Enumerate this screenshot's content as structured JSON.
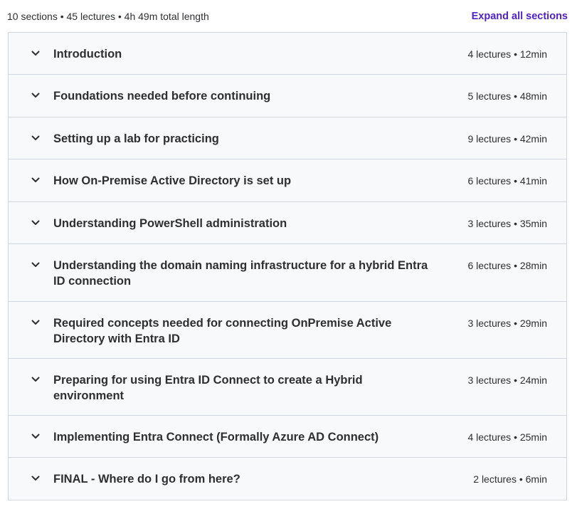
{
  "summary": {
    "text": "10 sections • 45 lectures • 4h 49m total length",
    "expand_all_label": "Expand all sections"
  },
  "sections": [
    {
      "title": "Introduction",
      "meta": "4 lectures • 12min"
    },
    {
      "title": "Foundations needed before continuing",
      "meta": "5 lectures • 48min"
    },
    {
      "title": "Setting up a lab for practicing",
      "meta": "9 lectures • 42min"
    },
    {
      "title": "How On-Premise Active Directory is set up",
      "meta": "6 lectures • 41min"
    },
    {
      "title": "Understanding PowerShell administration",
      "meta": "3 lectures • 35min"
    },
    {
      "title": "Understanding the domain naming infrastructure for a hybrid Entra ID connection",
      "meta": "6 lectures • 28min"
    },
    {
      "title": "Required concepts needed for connecting OnPremise Active Directory with Entra ID",
      "meta": "3 lectures • 29min"
    },
    {
      "title": "Preparing for using Entra ID Connect to create a Hybrid environment",
      "meta": "3 lectures • 24min"
    },
    {
      "title": "Implementing Entra Connect (Formally Azure AD Connect)",
      "meta": "4 lectures • 25min"
    },
    {
      "title": "FINAL - Where do I go from here?",
      "meta": "2 lectures • 6min"
    }
  ],
  "icons": {
    "section_toggle": "chevron-down-icon"
  },
  "colors": {
    "accent": "#5022c3",
    "row_background": "#f7f9fa",
    "border": "#d1d7dc",
    "text": "#2d2f31"
  }
}
